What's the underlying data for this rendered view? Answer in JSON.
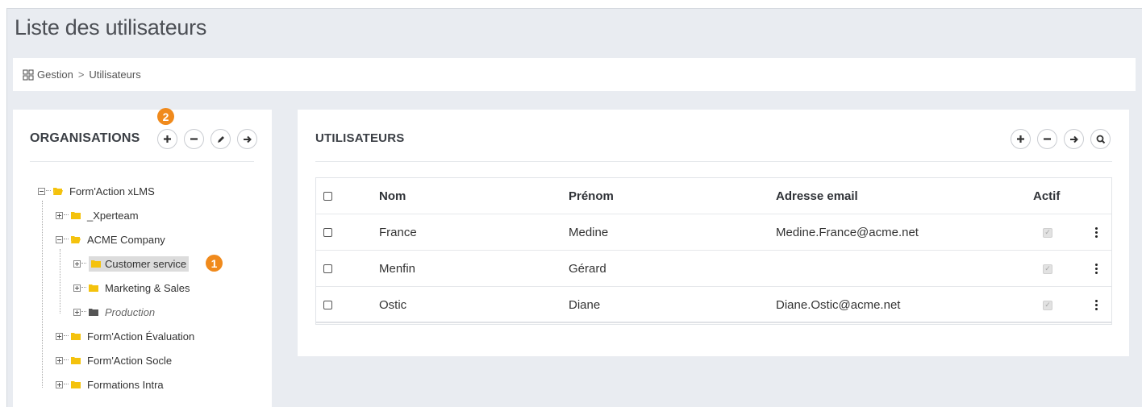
{
  "page": {
    "title": "Liste des utilisateurs"
  },
  "breadcrumb": {
    "icon": "grid-icon",
    "items": [
      "Gestion",
      "Utilisateurs"
    ],
    "separator": ">"
  },
  "organisations": {
    "title": "ORGANISATIONS",
    "badge": "2",
    "toolbar": [
      {
        "icon": "plus-icon",
        "name": "add"
      },
      {
        "icon": "minus-icon",
        "name": "remove"
      },
      {
        "icon": "pencil-icon",
        "name": "edit"
      },
      {
        "icon": "arrow-right-icon",
        "name": "move"
      }
    ],
    "tree": [
      {
        "label": "Form'Action xLMS",
        "level": 0,
        "expanded": true
      },
      {
        "label": "_Xperteam",
        "level": 1,
        "expanded": false
      },
      {
        "label": "ACME Company",
        "level": 1,
        "expanded": true
      },
      {
        "label": "Customer service",
        "level": 2,
        "expanded": false,
        "selected": true,
        "badge": "1"
      },
      {
        "label": "Marketing & Sales",
        "level": 2,
        "expanded": false
      },
      {
        "label": "Production",
        "level": 2,
        "expanded": false,
        "inactive": true
      },
      {
        "label": "Form'Action Évaluation",
        "level": 1,
        "expanded": false
      },
      {
        "label": "Form'Action Socle",
        "level": 1,
        "expanded": false
      },
      {
        "label": "Formations Intra",
        "level": 1,
        "expanded": false
      }
    ]
  },
  "utilisateurs": {
    "title": "UTILISATEURS",
    "toolbar": [
      {
        "icon": "plus-icon",
        "name": "add"
      },
      {
        "icon": "minus-icon",
        "name": "remove"
      },
      {
        "icon": "arrow-right-icon",
        "name": "move"
      },
      {
        "icon": "search-icon",
        "name": "search"
      }
    ],
    "columns": [
      "Nom",
      "Prénom",
      "Adresse email",
      "Actif"
    ],
    "rows": [
      {
        "nom": "France",
        "prenom": "Medine",
        "email": "Medine.France@acme.net",
        "actif": true
      },
      {
        "nom": "Menfin",
        "prenom": "Gérard",
        "email": "",
        "actif": true
      },
      {
        "nom": "Ostic",
        "prenom": "Diane",
        "email": "Diane.Ostic@acme.net",
        "actif": true
      }
    ]
  },
  "colors": {
    "accent_badge": "#f08a1c",
    "folder": "#f4c20d",
    "folder_inactive": "#555555",
    "background": "#e9ecf1"
  }
}
